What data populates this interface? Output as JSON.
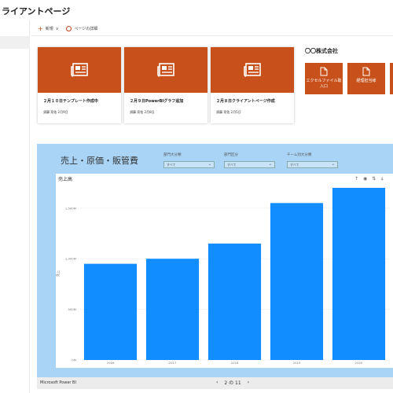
{
  "header": {
    "title": "ライアントページ"
  },
  "commandbar": {
    "new_label": "新規",
    "details_label": "ページの詳細"
  },
  "news": [
    {
      "title": "２月１０日テンプレート作成中",
      "meta": "須藤 亮佑 2月9日"
    },
    {
      "title": "２月９日PowerBIグラフ追加",
      "meta": "須藤 亮佑 2月8日"
    },
    {
      "title": "２月８日クライアントページ作成",
      "meta": "須藤 亮佑 2月5日"
    }
  ],
  "company": {
    "title": "〇〇株式会社",
    "links": [
      {
        "label": "エクセルファイル取入口",
        "icon": "document-icon"
      },
      {
        "label": "経理担当様",
        "icon": "document-icon"
      }
    ]
  },
  "powerbi": {
    "title": "売上・原価・販管費",
    "slicers": [
      {
        "label": "部門大分類",
        "value": "すべて"
      },
      {
        "label": "部門区分",
        "value": "すべて"
      },
      {
        "label": "チーム別大分類",
        "value": "すべて"
      }
    ],
    "footer_brand": "Microsoft Power BI",
    "page_indicator": "2 の 11"
  },
  "colors": {
    "card_accent": "#c8501a",
    "bar_color": "#118dff",
    "pbi_bg": "#aad4f5"
  },
  "chart_data": {
    "type": "bar",
    "title": "売上高",
    "ylabel": "売上",
    "categories": [
      "2016",
      "2017",
      "2018",
      "2019",
      "2020"
    ],
    "values": [
      950,
      1000,
      1150,
      1550,
      1700
    ],
    "ylim": [
      0,
      1700
    ],
    "yticks": [
      {
        "value": 0,
        "label": "0M"
      },
      {
        "value": 500,
        "label": "500M"
      },
      {
        "value": 1000,
        "label": "1,000M"
      },
      {
        "value": 1500,
        "label": "1,500M"
      }
    ],
    "grid": true
  }
}
